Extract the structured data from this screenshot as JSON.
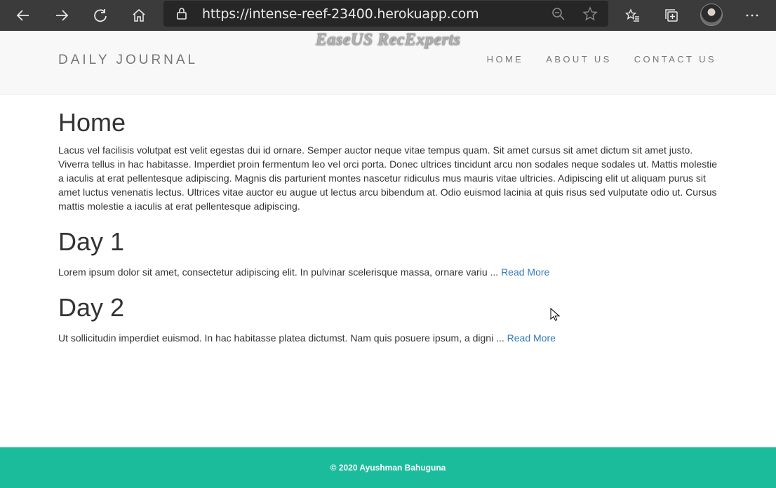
{
  "browser": {
    "url": "https://intense-reef-23400.herokuapp.com",
    "icons": [
      "back-icon",
      "forward-icon",
      "refresh-icon",
      "home-icon",
      "lock-icon",
      "zoom-icon",
      "favorite-star-icon",
      "favorites-icon",
      "collections-icon",
      "profile-avatar",
      "more-icon"
    ],
    "watermark": "EaseUS RecExperts"
  },
  "nav": {
    "brand": "DAILY JOURNAL",
    "links": [
      "HOME",
      "ABOUT US",
      "CONTACT US"
    ]
  },
  "home": {
    "title": "Home",
    "paragraph": "Lacus vel facilisis volutpat est velit egestas dui id ornare. Semper auctor neque vitae tempus quam. Sit amet cursus sit amet dictum sit amet justo. Viverra tellus in hac habitasse. Imperdiet proin fermentum leo vel orci porta. Donec ultrices tincidunt arcu non sodales neque sodales ut. Mattis molestie a iaculis at erat pellentesque adipiscing. Magnis dis parturient montes nascetur ridiculus mus mauris vitae ultricies. Adipiscing elit ut aliquam purus sit amet luctus venenatis lectus. Ultrices vitae auctor eu augue ut lectus arcu bibendum at. Odio euismod lacinia at quis risus sed vulputate odio ut. Cursus mattis molestie a iaculis at erat pellentesque adipiscing."
  },
  "posts": [
    {
      "title": "Day 1",
      "excerpt": "Lorem ipsum dolor sit amet, consectetur adipiscing elit. In pulvinar scelerisque massa, ornare variu ...",
      "read_more": "Read More"
    },
    {
      "title": "Day 2",
      "excerpt": "Ut sollicitudin imperdiet euismod. In hac habitasse platea dictumst. Nam quis posuere ipsum, a digni ...",
      "read_more": "Read More"
    }
  ],
  "footer": {
    "text": "© 2020 Ayushman Bahuguna"
  },
  "colors": {
    "chrome": "#3b3b3b",
    "address_bar": "#262626",
    "navbar": "#f8f8f8",
    "link": "#337ab7",
    "footer": "#1abc9c"
  }
}
